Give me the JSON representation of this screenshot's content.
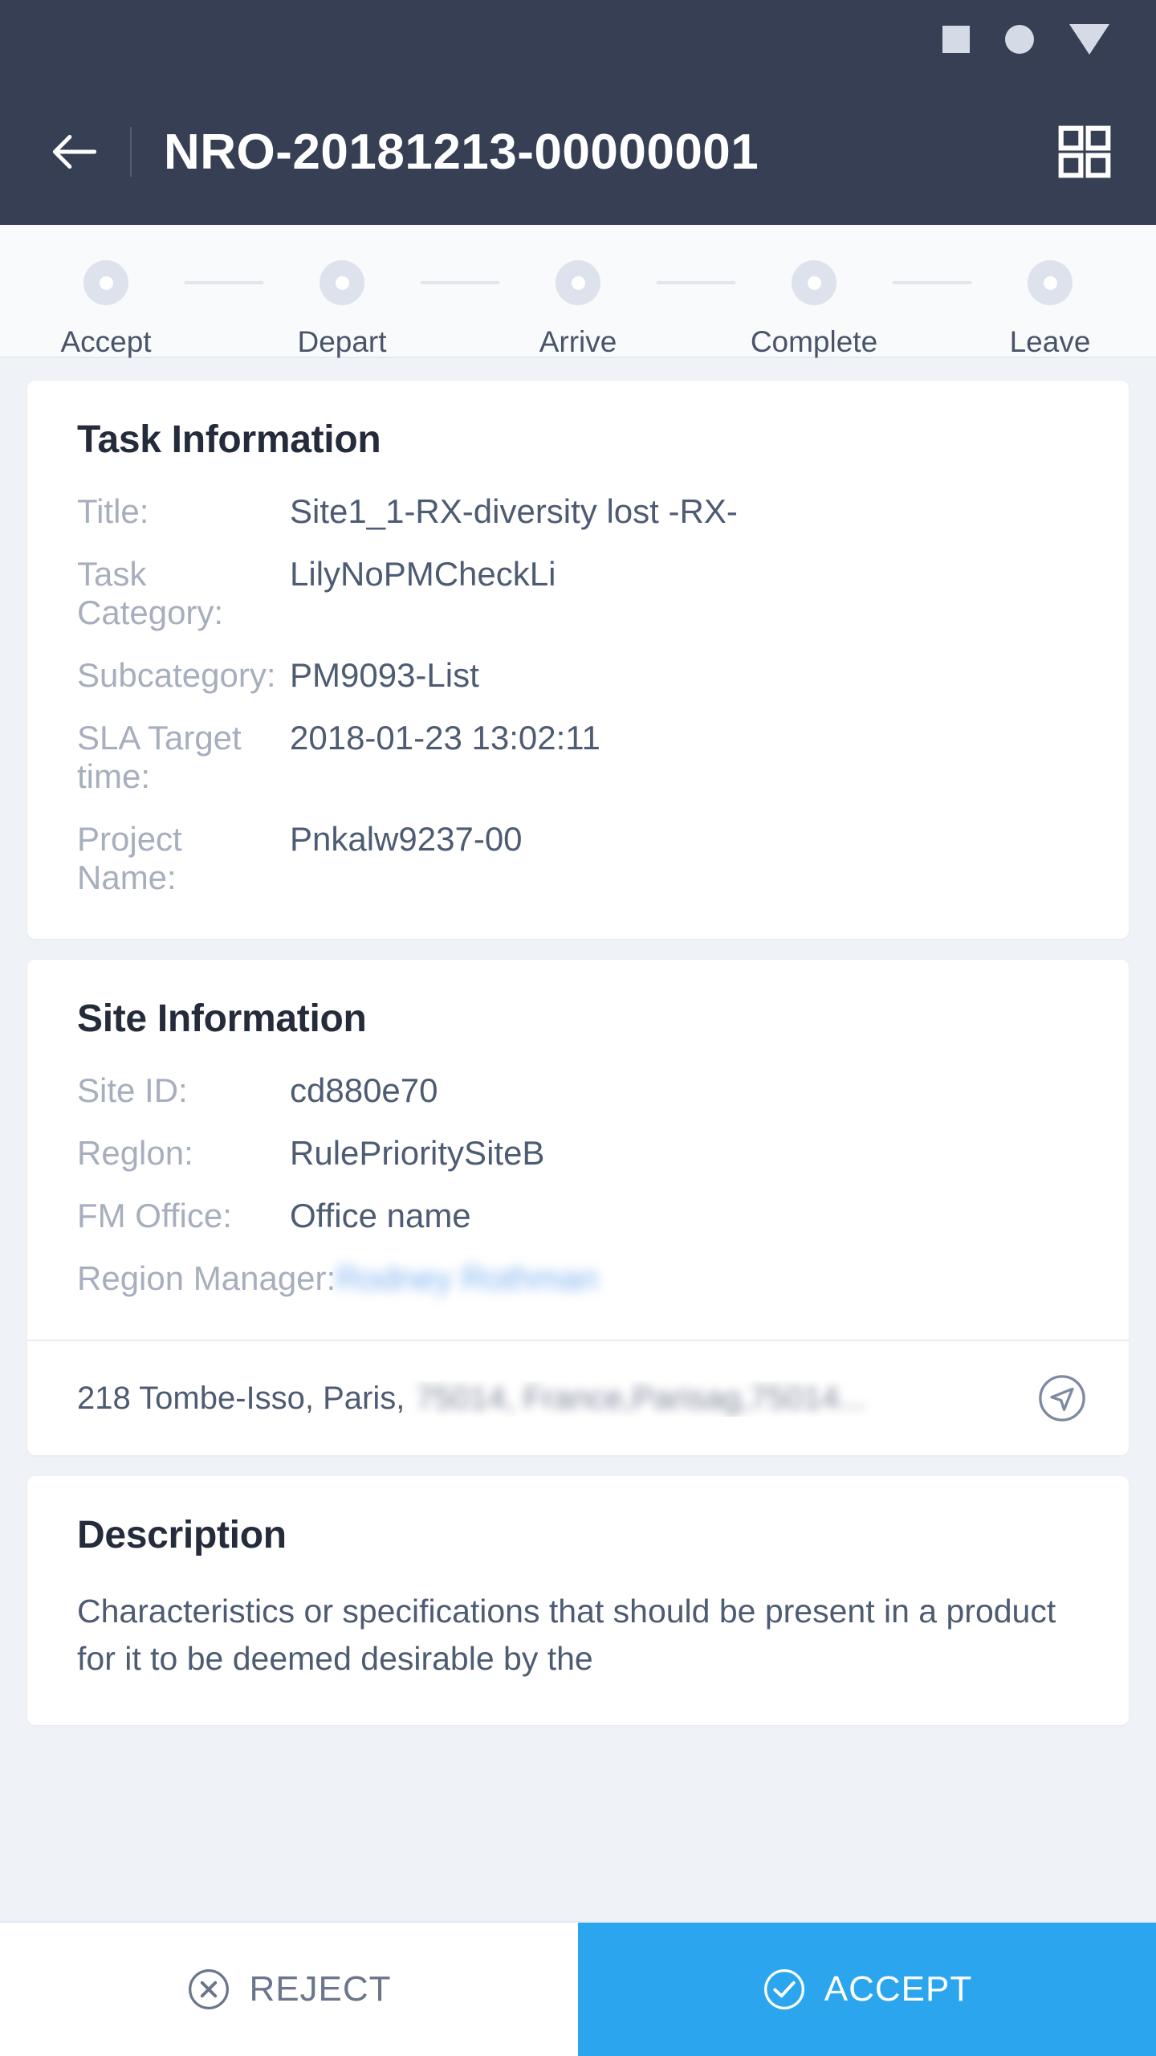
{
  "statusbar": {
    "icons": [
      "square-icon",
      "circle-icon",
      "triangle-down-icon"
    ]
  },
  "appbar": {
    "back_icon": "back-arrow-icon",
    "title": "NRO-20181213-00000001",
    "menu_icon": "grid-menu-icon"
  },
  "stepper": {
    "steps": [
      {
        "label": "Accept"
      },
      {
        "label": "Depart"
      },
      {
        "label": "Arrive"
      },
      {
        "label": "Complete"
      },
      {
        "label": "Leave"
      }
    ]
  },
  "task_information": {
    "title": "Task Information",
    "fields": [
      {
        "label": "Title:",
        "value": "Site1_1-RX-diversity lost -RX-"
      },
      {
        "label": "Task Category:",
        "value": "LilyNoPMCheckLi"
      },
      {
        "label": "Subcategory:",
        "value": "PM9093-List"
      },
      {
        "label": "SLA Target time:",
        "value": "2018-01-23 13:02:11"
      },
      {
        "label": "Project Name:",
        "value": "Pnkalw9237-00"
      }
    ]
  },
  "site_information": {
    "title": "Site Information",
    "fields": [
      {
        "label": "Site ID:",
        "value": "cd880e70"
      },
      {
        "label": "Reglon:",
        "value": "RulePrioritySiteB"
      },
      {
        "label": "FM Office:",
        "value": "Office name"
      }
    ],
    "region_manager_label": "Region Manager:",
    "region_manager_value": "Rodney Rothman",
    "address_visible": "218 Tombe-Isso, Paris,",
    "address_redacted": "75014, France,Parisag,75014...",
    "navigate_icon": "navigate-arrow-icon"
  },
  "description": {
    "title": "Description",
    "body": "Characteristics or specifications that should be present in a product for it to be deemed desirable by the"
  },
  "actions": {
    "reject_label": "REJECT",
    "reject_icon": "close-circle-icon",
    "accept_label": "ACCEPT",
    "accept_icon": "check-circle-icon"
  },
  "colors": {
    "header": "#373F54",
    "page_bg": "#EFF2F7",
    "accent": "#2BA6EE",
    "label": "#A7AEBD",
    "value": "#4D5B73"
  }
}
